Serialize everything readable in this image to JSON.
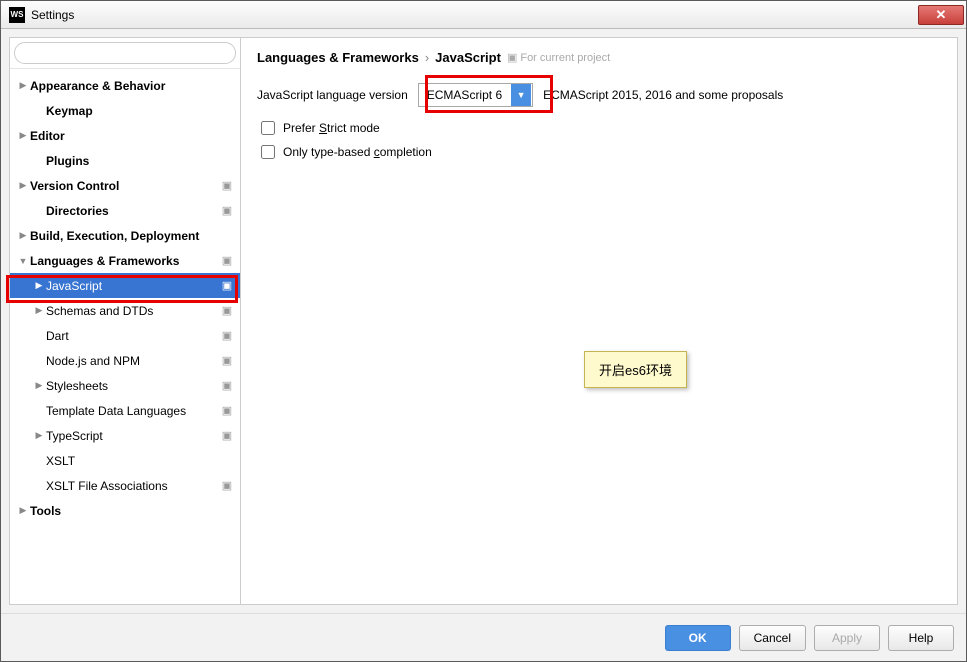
{
  "window": {
    "title": "Settings",
    "icon_text": "WS"
  },
  "search": {
    "placeholder": ""
  },
  "tree": [
    {
      "label": "Appearance & Behavior",
      "indent": 0,
      "arrow": "▶",
      "bold": true,
      "badge": false,
      "selected": false
    },
    {
      "label": "Keymap",
      "indent": 1,
      "arrow": "",
      "bold": true,
      "badge": false,
      "selected": false
    },
    {
      "label": "Editor",
      "indent": 0,
      "arrow": "▶",
      "bold": true,
      "badge": false,
      "selected": false
    },
    {
      "label": "Plugins",
      "indent": 1,
      "arrow": "",
      "bold": true,
      "badge": false,
      "selected": false
    },
    {
      "label": "Version Control",
      "indent": 0,
      "arrow": "▶",
      "bold": true,
      "badge": true,
      "selected": false
    },
    {
      "label": "Directories",
      "indent": 1,
      "arrow": "",
      "bold": true,
      "badge": true,
      "selected": false
    },
    {
      "label": "Build, Execution, Deployment",
      "indent": 0,
      "arrow": "▶",
      "bold": true,
      "badge": false,
      "selected": false
    },
    {
      "label": "Languages & Frameworks",
      "indent": 0,
      "arrow": "▼",
      "bold": true,
      "badge": true,
      "selected": false
    },
    {
      "label": "JavaScript",
      "indent": 1,
      "arrow": "▶",
      "bold": false,
      "badge": true,
      "selected": true
    },
    {
      "label": "Schemas and DTDs",
      "indent": 1,
      "arrow": "▶",
      "bold": false,
      "badge": true,
      "selected": false
    },
    {
      "label": "Dart",
      "indent": 1,
      "arrow": "",
      "bold": false,
      "badge": true,
      "selected": false
    },
    {
      "label": "Node.js and NPM",
      "indent": 1,
      "arrow": "",
      "bold": false,
      "badge": true,
      "selected": false
    },
    {
      "label": "Stylesheets",
      "indent": 1,
      "arrow": "▶",
      "bold": false,
      "badge": true,
      "selected": false
    },
    {
      "label": "Template Data Languages",
      "indent": 1,
      "arrow": "",
      "bold": false,
      "badge": true,
      "selected": false
    },
    {
      "label": "TypeScript",
      "indent": 1,
      "arrow": "▶",
      "bold": false,
      "badge": true,
      "selected": false
    },
    {
      "label": "XSLT",
      "indent": 1,
      "arrow": "",
      "bold": false,
      "badge": false,
      "selected": false
    },
    {
      "label": "XSLT File Associations",
      "indent": 1,
      "arrow": "",
      "bold": false,
      "badge": true,
      "selected": false
    },
    {
      "label": "Tools",
      "indent": 0,
      "arrow": "▶",
      "bold": true,
      "badge": false,
      "selected": false
    }
  ],
  "breadcrumb": {
    "part1": "Languages & Frameworks",
    "sep": "›",
    "part2": "JavaScript",
    "hint": "For current project"
  },
  "main": {
    "version_label": "JavaScript language version",
    "version_value": "ECMAScript 6",
    "version_hint": "ECMAScript 2015, 2016 and some proposals",
    "check_strict_pre": "Prefer ",
    "check_strict_u": "S",
    "check_strict_post": "trict mode",
    "check_completion_pre": "Only type-based ",
    "check_completion_u": "c",
    "check_completion_post": "ompletion"
  },
  "annotation": {
    "text": "开启es6环境"
  },
  "footer": {
    "ok": "OK",
    "cancel": "Cancel",
    "apply": "Apply",
    "help": "Help"
  }
}
